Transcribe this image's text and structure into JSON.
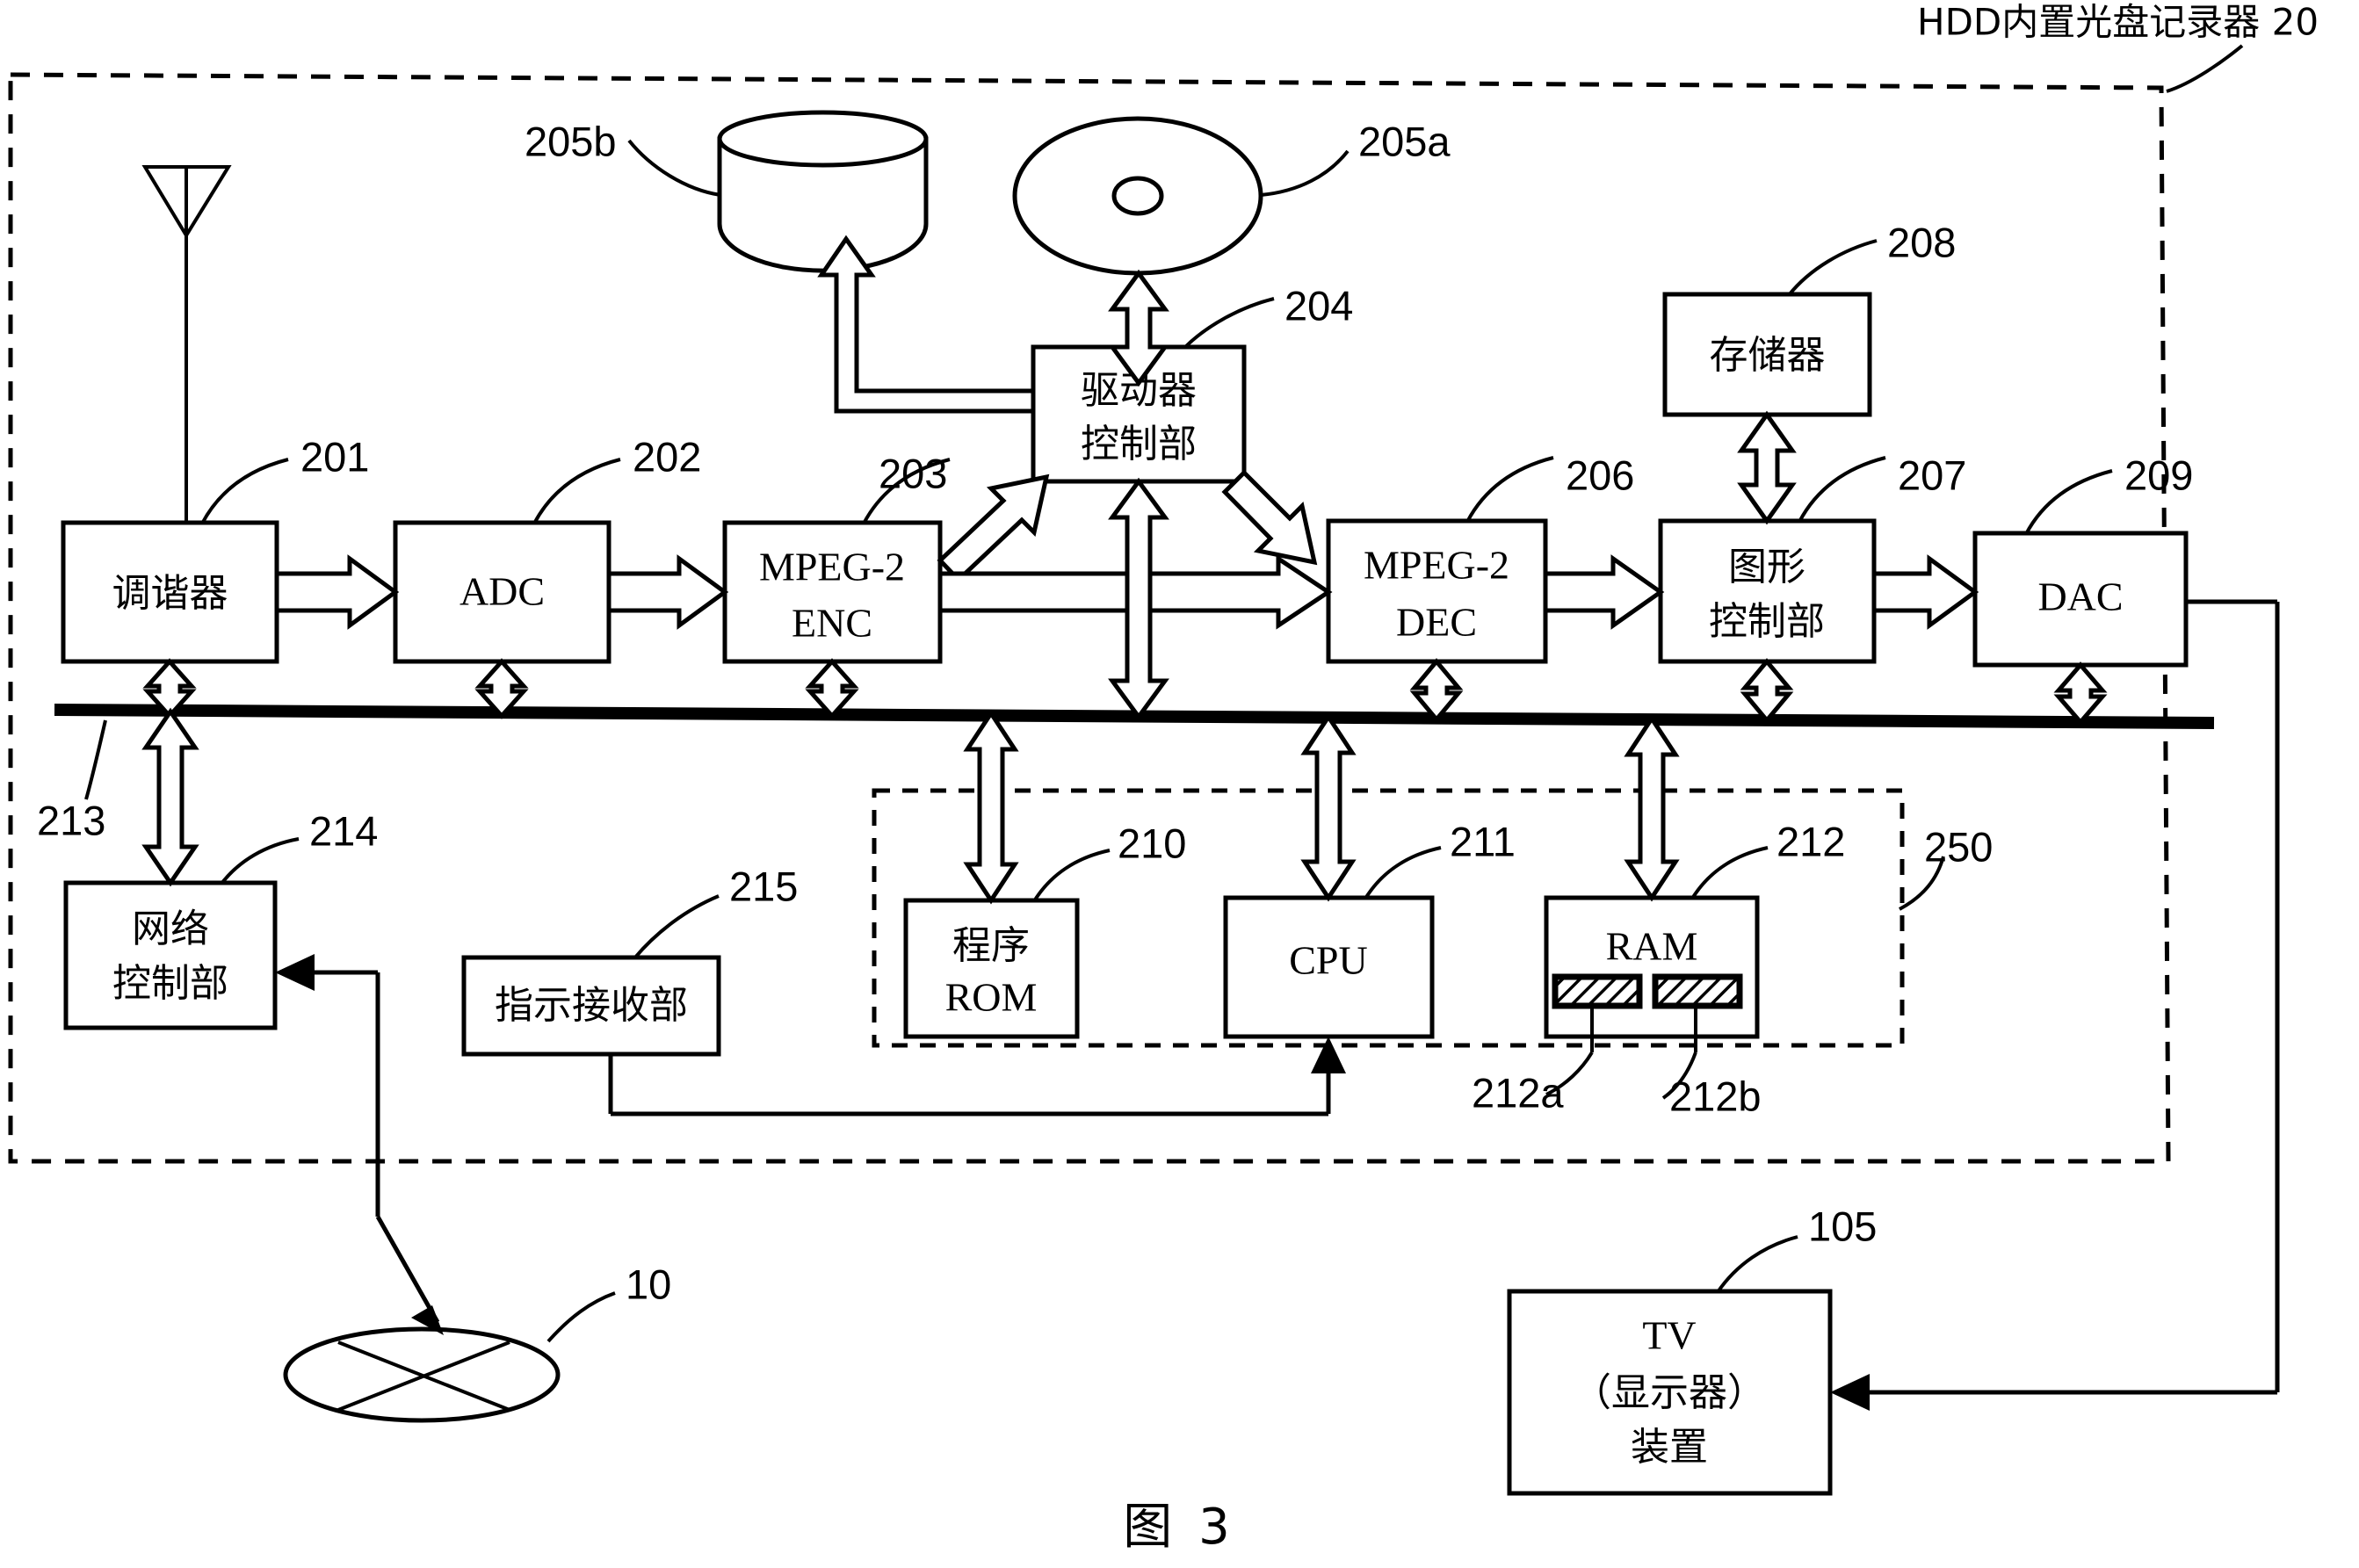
{
  "figure": {
    "caption": "图 3",
    "outer_label": "HDD内置光盘记录器 20"
  },
  "blocks": [
    {
      "id": "tuner",
      "lines": [
        "调谐器"
      ],
      "ref": "201",
      "type": "cjk"
    },
    {
      "id": "adc",
      "lines": [
        "ADC"
      ],
      "ref": "202",
      "type": "latin"
    },
    {
      "id": "mpeg_enc",
      "lines": [
        "MPEG-2",
        "ENC"
      ],
      "ref": "203",
      "type": "latin"
    },
    {
      "id": "drive_ctrl",
      "lines": [
        "驱动器",
        "控制部"
      ],
      "ref": "204",
      "type": "cjk"
    },
    {
      "id": "mpeg_dec",
      "lines": [
        "MPEG-2",
        "DEC"
      ],
      "ref": "206",
      "type": "latin"
    },
    {
      "id": "gfx_ctrl",
      "lines": [
        "图形",
        "控制部"
      ],
      "ref": "207",
      "type": "cjk"
    },
    {
      "id": "memory",
      "lines": [
        "存储器"
      ],
      "ref": "208",
      "type": "cjk"
    },
    {
      "id": "dac",
      "lines": [
        "DAC"
      ],
      "ref": "209",
      "type": "latin"
    },
    {
      "id": "net_ctrl",
      "lines": [
        "网络",
        "控制部"
      ],
      "ref": "214",
      "type": "cjk"
    },
    {
      "id": "cmd_rx",
      "lines": [
        "指示接收部"
      ],
      "ref": "215",
      "type": "cjk"
    },
    {
      "id": "prog_rom",
      "lines": [
        "程序",
        "ROM"
      ],
      "ref": "210",
      "type": "mixed"
    },
    {
      "id": "cpu",
      "lines": [
        "CPU"
      ],
      "ref": "211",
      "type": "latin"
    },
    {
      "id": "ram",
      "lines": [
        "RAM"
      ],
      "ref": "212",
      "type": "latin"
    },
    {
      "id": "tv",
      "lines": [
        "TV",
        "（显示器）",
        "装置"
      ],
      "ref": "105",
      "type": "cjk"
    }
  ],
  "symbols": [
    {
      "id": "hdd",
      "name": "hdd-cylinder-icon",
      "ref": "205b"
    },
    {
      "id": "disc",
      "name": "optical-disc-icon",
      "ref": "205a"
    },
    {
      "id": "antenna",
      "name": "antenna-icon",
      "ref": ""
    },
    {
      "id": "network",
      "name": "network-cloud-icon",
      "ref": "10"
    }
  ],
  "refs": {
    "r201": "201",
    "r202": "202",
    "r203": "203",
    "r204": "204",
    "r205a": "205a",
    "r205b": "205b",
    "r206": "206",
    "r207": "207",
    "r208": "208",
    "r209": "209",
    "r210": "210",
    "r211": "211",
    "r212": "212",
    "r212a": "212a",
    "r212b": "212b",
    "r213": "213",
    "r214": "214",
    "r215": "215",
    "r250": "250",
    "r105": "105",
    "r10": "10"
  },
  "labels": {
    "tuner": "调谐器",
    "adc": "ADC",
    "mpeg_enc_1": "MPEG-2",
    "mpeg_enc_2": "ENC",
    "drive_ctrl_1": "驱动器",
    "drive_ctrl_2": "控制部",
    "mpeg_dec_1": "MPEG-2",
    "mpeg_dec_2": "DEC",
    "gfx_ctrl_1": "图形",
    "gfx_ctrl_2": "控制部",
    "memory": "存储器",
    "dac": "DAC",
    "net_ctrl_1": "网络",
    "net_ctrl_2": "控制部",
    "cmd_rx": "指示接收部",
    "prog_rom_1": "程序",
    "prog_rom_2": "ROM",
    "cpu": "CPU",
    "ram": "RAM",
    "tv_1": "TV",
    "tv_2": "（显示器）",
    "tv_3": "装置"
  }
}
